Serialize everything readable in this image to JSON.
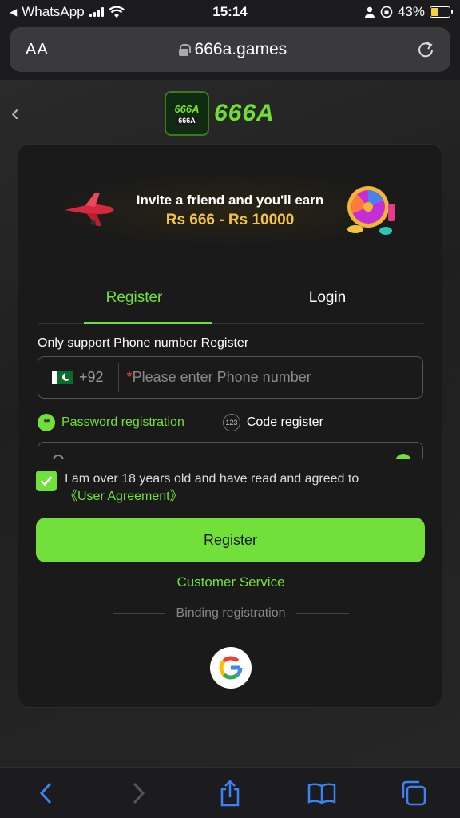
{
  "status": {
    "back_app": "WhatsApp",
    "time": "15:14",
    "battery": "43%"
  },
  "browser": {
    "aa_label": "AA",
    "url": "666a.games"
  },
  "logo": {
    "badge_top": "666A",
    "badge_bottom": "666A",
    "wordmark": "666A"
  },
  "banner": {
    "line1": "Invite a friend and you'll earn",
    "line2": "Rs 666 - Rs 10000"
  },
  "tabs": [
    {
      "label": "Register",
      "active": true
    },
    {
      "label": "Login",
      "active": false
    }
  ],
  "form": {
    "hint": "Only support Phone number Register",
    "country_code": "+92",
    "phone_required_mark": "*",
    "phone_placeholder": "Please enter Phone number",
    "option_password": "Password registration",
    "option_code": "Code register",
    "option_code_icon_text": "123",
    "agree_text": "I am over 18 years old and have read and agreed to",
    "agree_link": "《User Agreement》",
    "submit_label": "Register",
    "customer_service": "Customer Service",
    "binding_label": "Binding registration"
  },
  "colors": {
    "accent": "#72e03a",
    "card": "#1a1a1a",
    "banner_gold": "#f5c542"
  },
  "toolbar": {
    "icons": [
      "back-icon",
      "forward-icon",
      "share-icon",
      "bookmarks-icon",
      "tabs-icon"
    ]
  }
}
